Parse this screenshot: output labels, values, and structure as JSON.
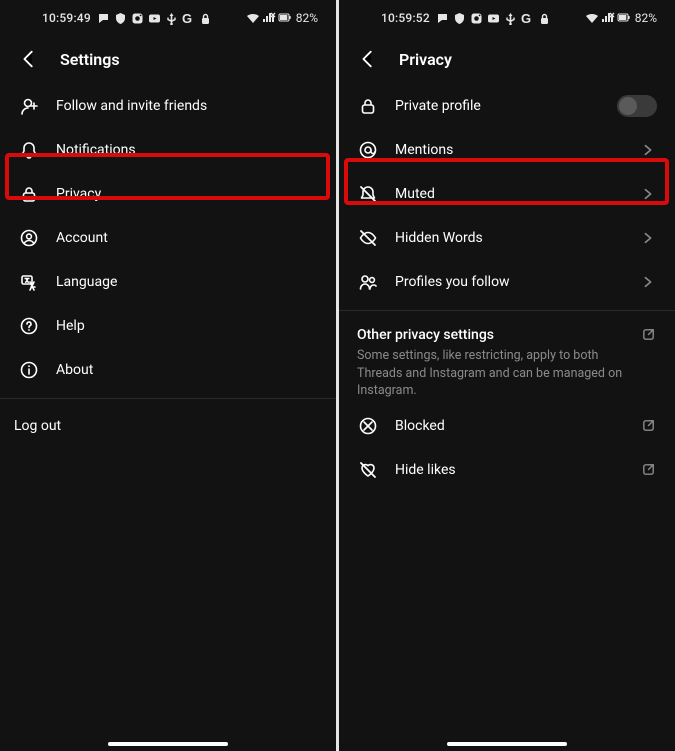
{
  "left": {
    "status": {
      "time": "10:59:49",
      "battery_pct": "82%"
    },
    "header": {
      "title": "Settings"
    },
    "items": [
      {
        "label": "Follow and invite friends"
      },
      {
        "label": "Notifications"
      },
      {
        "label": "Privacy"
      },
      {
        "label": "Account"
      },
      {
        "label": "Language"
      },
      {
        "label": "Help"
      },
      {
        "label": "About"
      }
    ],
    "logout": "Log out"
  },
  "right": {
    "status": {
      "time": "10:59:52",
      "battery_pct": "82%"
    },
    "header": {
      "title": "Privacy"
    },
    "items": [
      {
        "label": "Private profile"
      },
      {
        "label": "Mentions"
      },
      {
        "label": "Muted"
      },
      {
        "label": "Hidden Words"
      },
      {
        "label": "Profiles you follow"
      }
    ],
    "section": {
      "title": "Other privacy settings",
      "sub": "Some settings, like restricting, apply to both Threads and Instagram and can be managed on Instagram."
    },
    "extra": [
      {
        "label": "Blocked"
      },
      {
        "label": "Hide likes"
      }
    ]
  }
}
